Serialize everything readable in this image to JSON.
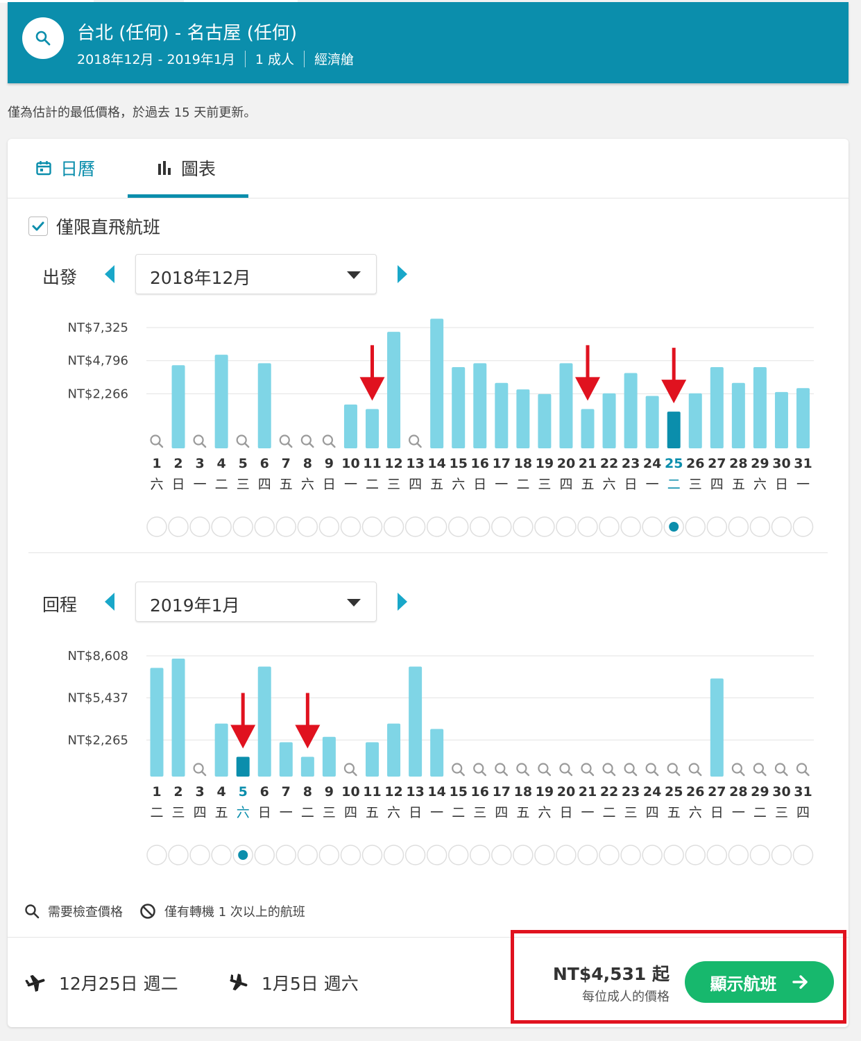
{
  "header": {
    "route": "台北 (任何) - 名古屋 (任何)",
    "dates": "2018年12月 - 2019年1月",
    "passengers": "1 成人",
    "cabin": "經濟艙",
    "color": "#0b8eac"
  },
  "notice": "僅為估計的最低價格，於過去 15 天前更新。",
  "tabs": [
    {
      "label": "日曆",
      "icon": "calendar-icon",
      "active": false
    },
    {
      "label": "圖表",
      "icon": "bar-chart-icon",
      "active": true
    }
  ],
  "direct_only": {
    "label": "僅限直飛航班",
    "checked": true
  },
  "outbound": {
    "label": "出發",
    "month": "2018年12月"
  },
  "return": {
    "label": "回程",
    "month": "2019年1月"
  },
  "chart_data": [
    {
      "type": "bar",
      "name": "outbound",
      "x": [
        1,
        2,
        3,
        4,
        5,
        6,
        7,
        8,
        9,
        10,
        11,
        12,
        13,
        14,
        15,
        16,
        17,
        18,
        19,
        20,
        21,
        22,
        23,
        24,
        25,
        26,
        27,
        28,
        29,
        30,
        31
      ],
      "weekdays": [
        "六",
        "日",
        "一",
        "二",
        "三",
        "四",
        "五",
        "六",
        "日",
        "一",
        "二",
        "三",
        "四",
        "五",
        "六",
        "日",
        "一",
        "二",
        "三",
        "四",
        "五",
        "六",
        "日",
        "一",
        "二",
        "三",
        "四",
        "五",
        "六",
        "日",
        "一"
      ],
      "values": [
        null,
        4450,
        null,
        5250,
        null,
        4600,
        null,
        null,
        null,
        1450,
        1100,
        7000,
        null,
        8000,
        4300,
        4600,
        3100,
        2600,
        2250,
        4600,
        1100,
        2300,
        3850,
        2100,
        900,
        2300,
        4300,
        3100,
        4300,
        2400,
        2700
      ],
      "yticks": [
        {
          "value": 2266,
          "label": "NT$2,266"
        },
        {
          "value": 4796,
          "label": "NT$4,796"
        },
        {
          "value": 7325,
          "label": "NT$7,325"
        }
      ],
      "ylim": [
        -1900,
        7325
      ],
      "selected_day": 25,
      "marked_days": [
        11,
        21,
        25
      ],
      "bar_color": "#7fd5e6",
      "selected_color": "#0b8eac",
      "marker_color": "#e0121f"
    },
    {
      "type": "bar",
      "name": "return",
      "x": [
        1,
        2,
        3,
        4,
        5,
        6,
        7,
        8,
        9,
        10,
        11,
        12,
        13,
        14,
        15,
        16,
        17,
        18,
        19,
        20,
        21,
        22,
        23,
        24,
        25,
        26,
        27,
        28,
        29,
        30,
        31
      ],
      "weekdays": [
        "二",
        "三",
        "四",
        "五",
        "六",
        "日",
        "一",
        "二",
        "三",
        "四",
        "五",
        "六",
        "日",
        "一",
        "二",
        "三",
        "四",
        "五",
        "六",
        "日",
        "一",
        "二",
        "三",
        "四",
        "五",
        "六",
        "日",
        "一",
        "二",
        "三",
        "四"
      ],
      "values": [
        7700,
        8400,
        null,
        3500,
        1000,
        7800,
        2100,
        1000,
        2500,
        null,
        2100,
        3500,
        7800,
        3100,
        null,
        null,
        null,
        null,
        null,
        null,
        null,
        null,
        null,
        null,
        null,
        null,
        6900,
        null,
        null,
        null,
        null
      ],
      "yticks": [
        {
          "value": 2265,
          "label": "NT$2,265"
        },
        {
          "value": 5437,
          "label": "NT$5,437"
        },
        {
          "value": 8608,
          "label": "NT$8,608"
        }
      ],
      "ylim": [
        -491,
        8608
      ],
      "selected_day": 5,
      "marked_days": [
        5,
        8
      ],
      "bar_color": "#7fd5e6",
      "selected_color": "#0b8eac",
      "marker_color": "#e0121f"
    }
  ],
  "legend": [
    {
      "icon": "search-icon",
      "label": "需要檢查價格"
    },
    {
      "icon": "no-entry-icon",
      "label": "僅有轉機 1 次以上的航班"
    }
  ],
  "footer": {
    "depart": "12月25日 週二",
    "return": "1月5日 週六",
    "price": "NT$4,531 起",
    "price_note": "每位成人的價格",
    "cta": "顯示航班",
    "cta_color": "#17b86d",
    "highlight_color": "#e0121f"
  }
}
